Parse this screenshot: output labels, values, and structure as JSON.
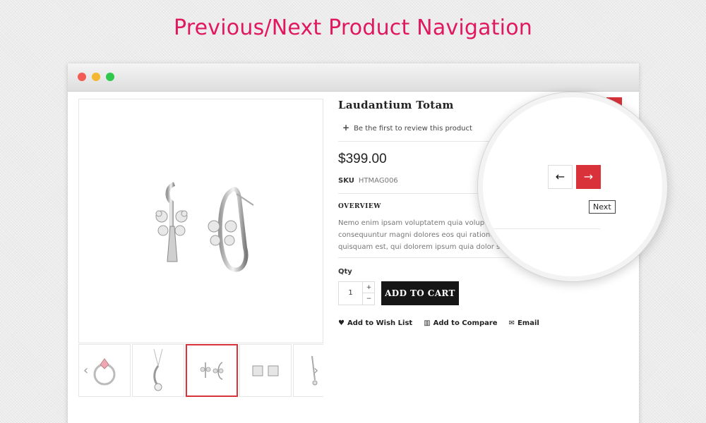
{
  "headline": "Previous/Next Product Navigation",
  "product": {
    "title": "Laudantium Totam",
    "review_link": "Be the first to review this product",
    "price": "$399.00",
    "sku_label": "SKU",
    "sku_value": "HTMAG006",
    "overview_heading": "OVERVIEW",
    "overview_lines": [
      "Nemo enim ipsam voluptatem quia voluptas sit asp",
      "consequuntur magni dolores eos qui ratione voluptat",
      "quisquam est, qui dolorem ipsum quia dolor sit amet, co"
    ],
    "qty_label": "Qty",
    "qty_value": "1",
    "qty_up": "+",
    "qty_down": "−",
    "add_to_cart": "ADD TO CART",
    "wishlist": "Add to Wish List",
    "compare": "Add to Compare",
    "email": "Email"
  },
  "navigation": {
    "prev_symbol": "←",
    "next_symbol": "→",
    "tooltip": "Next"
  },
  "thumbnails": [
    "ring",
    "pendant",
    "butterfly-earrings",
    "stud-earrings",
    "drop-earring"
  ],
  "colors": {
    "headline": "#e0185f",
    "accent": "#d9323a",
    "cart_button": "#161616"
  }
}
